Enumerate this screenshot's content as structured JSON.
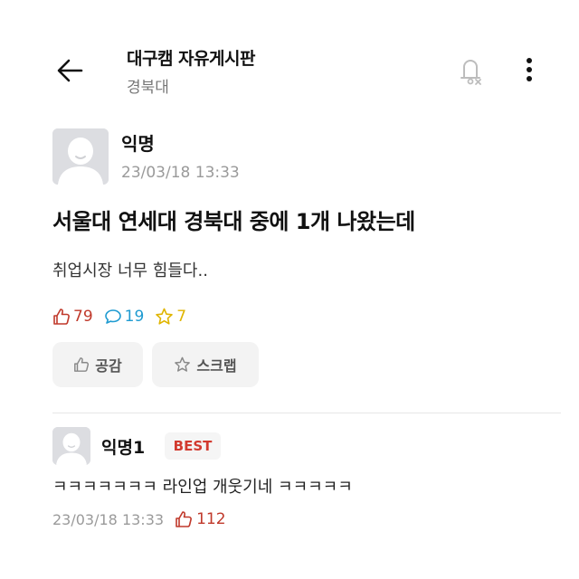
{
  "header": {
    "board_title": "대구캠 자유게시판",
    "board_subtitle": "경북대",
    "icons": [
      "back-arrow-icon",
      "bell-off-icon",
      "more-vertical-icon"
    ]
  },
  "post": {
    "author": "익명",
    "time": "23/03/18 13:33",
    "title": "서울대 연세대 경북대 중에 1개 나왔는데",
    "body": "취업시장 너무 힘들다..",
    "likes": "79",
    "comments": "19",
    "scraps": "7",
    "like_button": "공감",
    "scrap_button": "스크랩"
  },
  "comment": {
    "author": "익명1",
    "badge": "BEST",
    "text": "ㅋㅋㅋㅋㅋㅋㅋ 라인업 개웃기네 ㅋㅋㅋㅋㅋ",
    "time": "23/03/18 13:33",
    "likes": "112"
  },
  "colors": {
    "like": "#c0392b",
    "comment": "#1f9bd1",
    "scrap": "#e0b500",
    "badge_text": "#d23a2f"
  }
}
